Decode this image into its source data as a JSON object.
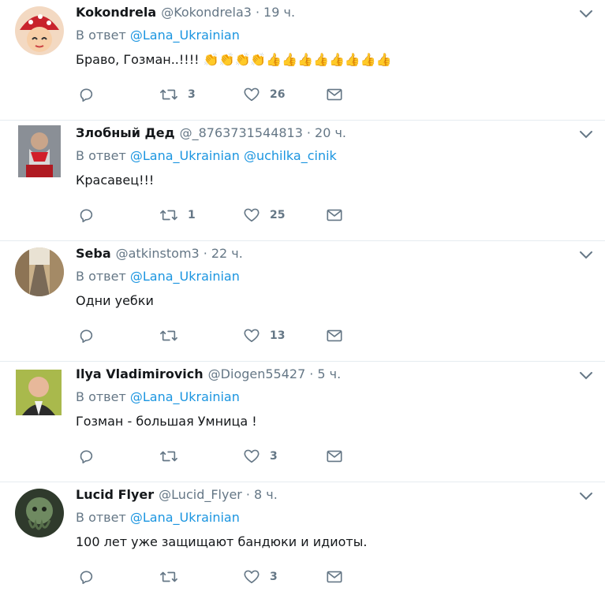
{
  "reply_prefix": "В ответ",
  "tweets": [
    {
      "name": "Kokondrela",
      "handle": "@Kokondrela3",
      "dot": "·",
      "time": "19 ч.",
      "mentions": [
        "@Lana_Ukrainian"
      ],
      "text": "Браво, Гозман..!!!! 👏👏👏👏👍👍👍👍👍👍👍👍",
      "retweets": "3",
      "likes": "26",
      "replies": ""
    },
    {
      "name": "Злобный Дед",
      "handle": "@_8763731544813",
      "dot": "·",
      "time": "20 ч.",
      "mentions": [
        "@Lana_Ukrainian",
        "@uchilka_cinik"
      ],
      "text": "Красавец!!!",
      "retweets": "1",
      "likes": "25",
      "replies": ""
    },
    {
      "name": "Seba",
      "handle": "@atkinstom3",
      "dot": "·",
      "time": "22 ч.",
      "mentions": [
        "@Lana_Ukrainian"
      ],
      "text": "Одни уебки",
      "retweets": "",
      "likes": "13",
      "replies": ""
    },
    {
      "name": "Ilya Vladimirovich",
      "handle": "@Diogen55427",
      "dot": "·",
      "time": "5 ч.",
      "mentions": [
        "@Lana_Ukrainian"
      ],
      "text": "Гозман - большая Умница !",
      "retweets": "",
      "likes": "3",
      "replies": ""
    },
    {
      "name": "Lucid Flyer",
      "handle": "@Lucid_Flyer",
      "dot": "·",
      "time": "8 ч.",
      "mentions": [
        "@Lana_Ukrainian"
      ],
      "text": "100 лет уже защищают бандюки и идиоты.",
      "retweets": "",
      "likes": "3",
      "replies": ""
    }
  ],
  "icons": {
    "reply": "reply-icon",
    "retweet": "retweet-icon",
    "like": "heart-icon",
    "dm": "envelope-icon",
    "caret": "chevron-down-icon"
  },
  "colors": {
    "link": "#1b95e0",
    "secondary_text": "#657786",
    "primary_text": "#14171a",
    "divider": "#e6ecf0"
  }
}
